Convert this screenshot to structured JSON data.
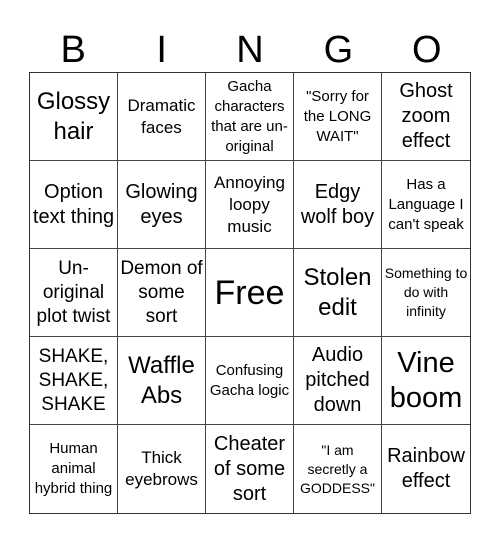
{
  "header": {
    "letters": [
      "B",
      "I",
      "N",
      "G",
      "O"
    ]
  },
  "cells": [
    "Glossy hair",
    "Dramatic faces",
    "Gacha characters that are un-original",
    "\"Sorry for the LONG WAIT\"",
    "Ghost zoom effect",
    "Option text thing",
    "Glowing eyes",
    "Annoying loopy music",
    "Edgy wolf boy",
    "Has a Language I can't speak",
    "Un-original plot twist",
    "Demon of some sort",
    "Free",
    "Stolen edit",
    "Something to do with infinity",
    "SHAKE, SHAKE, SHAKE",
    "Waffle Abs",
    "Confusing Gacha logic",
    "Audio pitched down",
    "Vine boom",
    "Human animal hybrid thing",
    "Thick eyebrows",
    "Cheater of some sort",
    "\"I am secretly a GODDESS\"",
    "Rainbow effect"
  ]
}
